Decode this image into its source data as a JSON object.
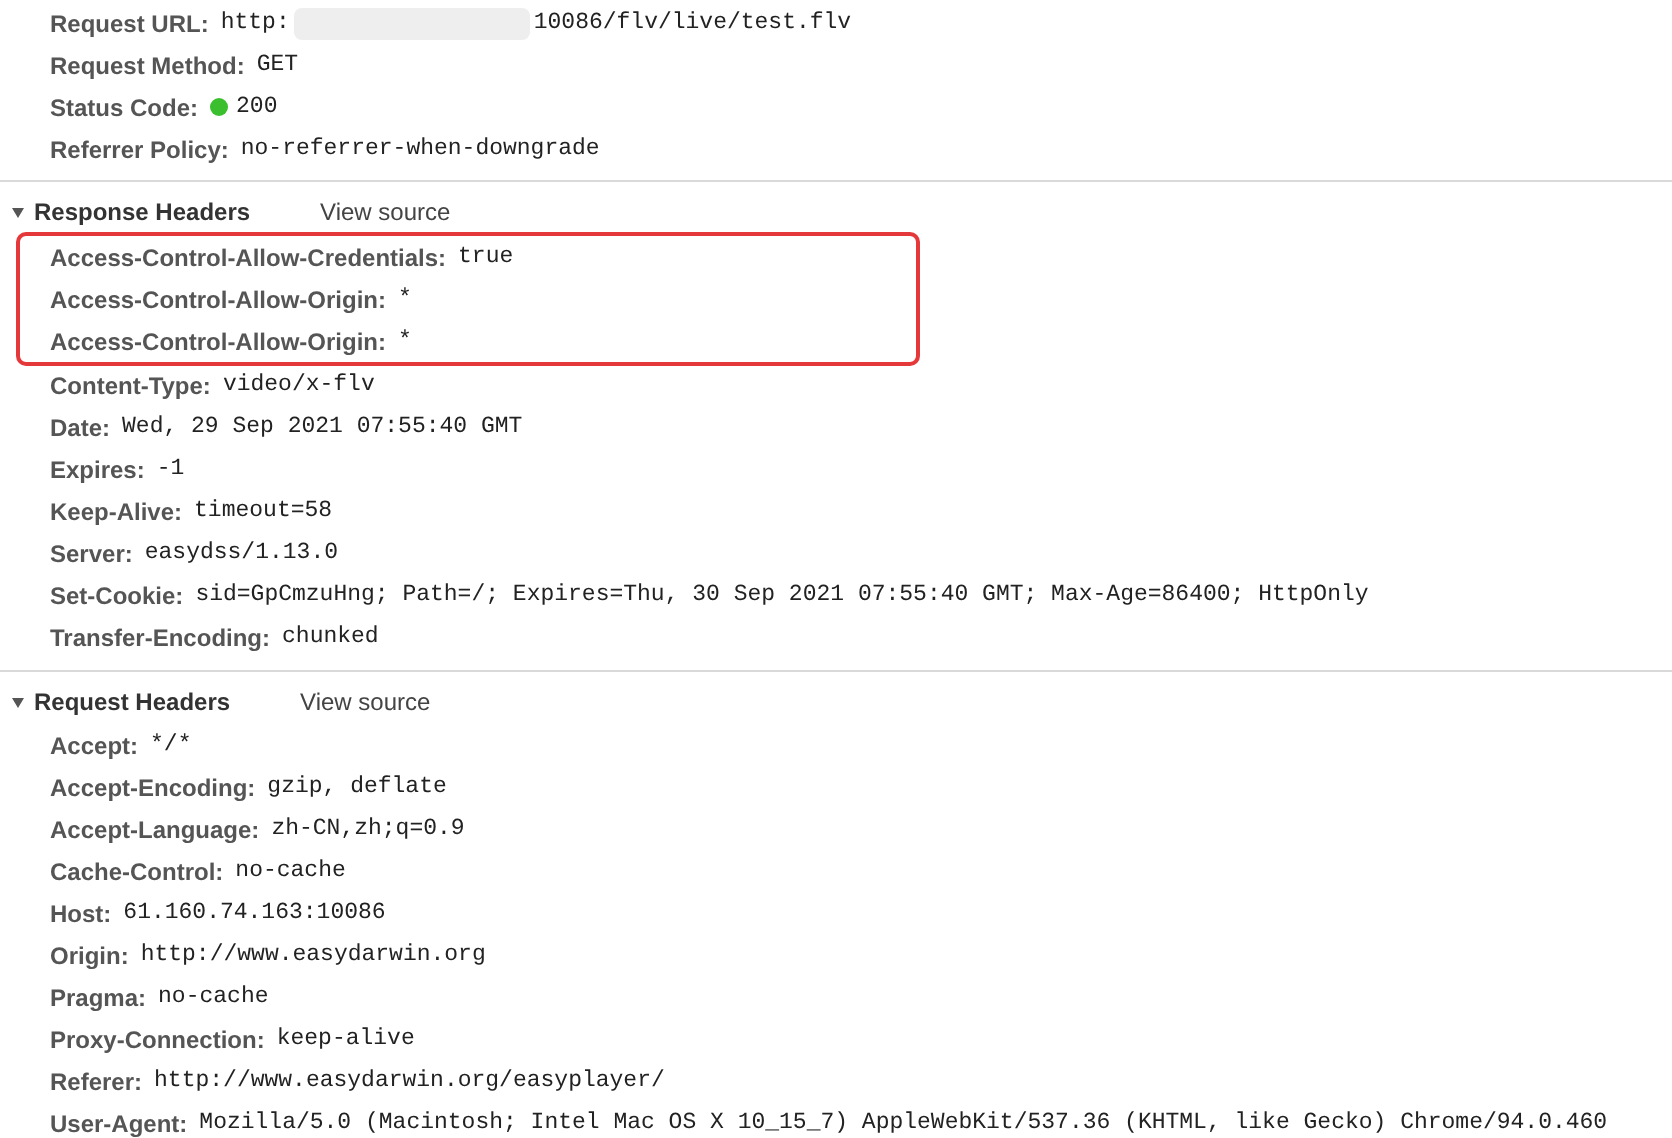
{
  "general": [
    {
      "name": "Request URL:",
      "kind": "redacted_url",
      "value_start": "http:",
      "value_end": "10086/flv/live/test.flv"
    },
    {
      "name": "Request Method:",
      "kind": "plain",
      "value": "GET"
    },
    {
      "name": "Status Code:",
      "kind": "status",
      "color": "#3bbf2f",
      "value": "200"
    },
    {
      "name": "Referrer Policy:",
      "kind": "plain",
      "value": "no-referrer-when-downgrade"
    }
  ],
  "sections": [
    {
      "title": "Response Headers",
      "expanded": true,
      "link": "View source",
      "headers": [
        {
          "name": "Access-Control-Allow-Credentials:",
          "value": "true",
          "highlighted": true
        },
        {
          "name": "Access-Control-Allow-Origin:",
          "value": "*",
          "highlighted": true
        },
        {
          "name": "Access-Control-Allow-Origin:",
          "value": "*",
          "highlighted": true
        },
        {
          "name": "Content-Type:",
          "value": "video/x-flv",
          "highlighted": false
        },
        {
          "name": "Date:",
          "value": "Wed, 29 Sep 2021 07:55:40 GMT",
          "highlighted": false
        },
        {
          "name": "Expires:",
          "value": "-1",
          "highlighted": false
        },
        {
          "name": "Keep-Alive:",
          "value": "timeout=58",
          "highlighted": false
        },
        {
          "name": "Server:",
          "value": "easydss/1.13.0",
          "highlighted": false
        },
        {
          "name": "Set-Cookie:",
          "value": "sid=GpCmzuHng; Path=/; Expires=Thu, 30 Sep 2021 07:55:40 GMT; Max-Age=86400; HttpOnly",
          "highlighted": false
        },
        {
          "name": "Transfer-Encoding:",
          "value": "chunked",
          "highlighted": false
        }
      ]
    },
    {
      "title": "Request Headers",
      "expanded": true,
      "link": "View source",
      "headers": [
        {
          "name": "Accept:",
          "value": "*/*",
          "highlighted": false
        },
        {
          "name": "Accept-Encoding:",
          "value": "gzip, deflate",
          "highlighted": false
        },
        {
          "name": "Accept-Language:",
          "value": "zh-CN,zh;q=0.9",
          "highlighted": false
        },
        {
          "name": "Cache-Control:",
          "value": "no-cache",
          "highlighted": false
        },
        {
          "name": "Host:",
          "value": "61.160.74.163:10086",
          "highlighted": false
        },
        {
          "name": "Origin:",
          "value": "http://www.easydarwin.org",
          "highlighted": false
        },
        {
          "name": "Pragma:",
          "value": "no-cache",
          "highlighted": false
        },
        {
          "name": "Proxy-Connection:",
          "value": "keep-alive",
          "highlighted": false
        },
        {
          "name": "Referer:",
          "value": "http://www.easydarwin.org/easyplayer/",
          "highlighted": false
        },
        {
          "name": "User-Agent:",
          "value": "Mozilla/5.0 (Macintosh; Intel Mac OS X 10_15_7) AppleWebKit/537.36 (KHTML, like Gecko) Chrome/94.0.460",
          "highlighted": false
        }
      ]
    }
  ]
}
